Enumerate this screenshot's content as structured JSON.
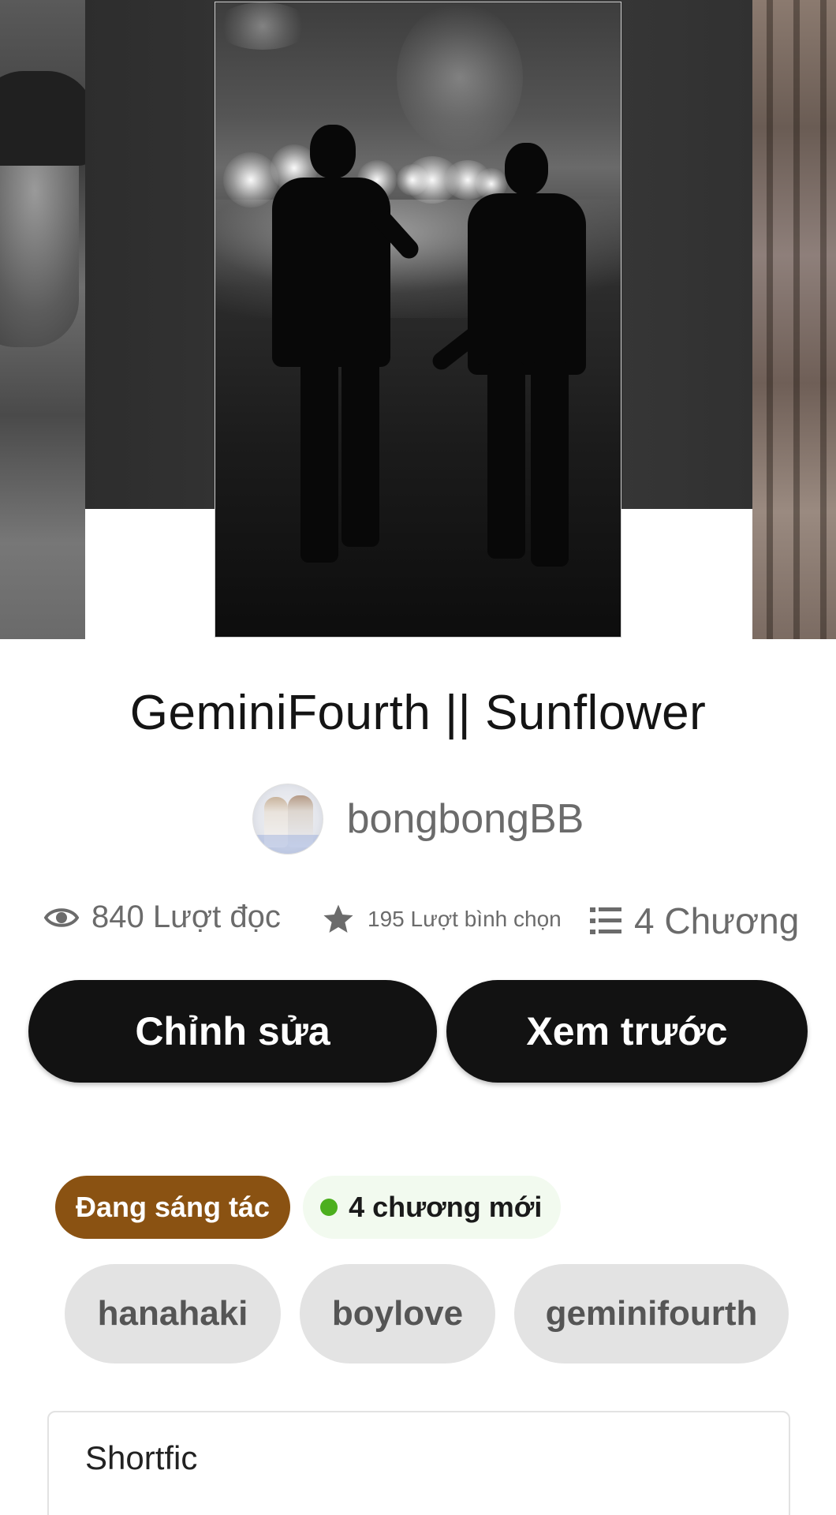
{
  "book": {
    "title": "GeminiFourth || Sunflower",
    "author": "bongbongBB"
  },
  "stats": {
    "reads": "840 Lượt đọc",
    "votes": "195 Lượt bình chọn",
    "parts": "4 Chương"
  },
  "actions": {
    "edit_label": "Chỉnh sửa",
    "preview_label": "Xem trước"
  },
  "badges": {
    "status": "Đang sáng tác",
    "new_parts": "4 chương mới"
  },
  "tags": [
    "hanahaki",
    "boylove",
    "geminifourth"
  ],
  "description": "Shortfic",
  "icons": {
    "reads": "eye-icon",
    "votes": "star-icon",
    "parts": "list-icon"
  },
  "colors": {
    "button_bg": "#121212",
    "status_badge": "#8a5212",
    "new_parts_dot": "#4caf1e",
    "tag_bg": "#e3e3e3"
  }
}
